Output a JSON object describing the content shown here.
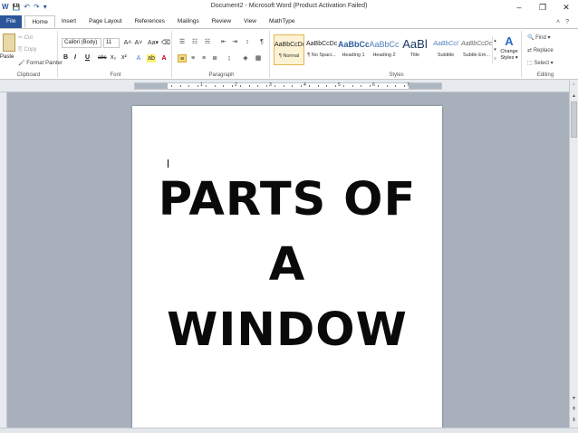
{
  "window": {
    "title": "Document2 - Microsoft Word (Product Activation Failed)",
    "controls": {
      "minimize": "–",
      "maximize": "❐",
      "close": "✕"
    }
  },
  "quick_access": {
    "word_icon": "W",
    "save": "💾",
    "undo": "↶",
    "redo": "↷",
    "customize": "▾"
  },
  "tabs": [
    "File",
    "Home",
    "Insert",
    "Page Layout",
    "References",
    "Mailings",
    "Review",
    "View",
    "MathType"
  ],
  "ribbon": {
    "clipboard": {
      "paste": "Paste",
      "cut": "Cut",
      "copy": "Copy",
      "format_painter": "Format Painter",
      "label": "Clipboard"
    },
    "font": {
      "name": "Calibri (Body)",
      "size": "11",
      "grow": "A˄",
      "shrink": "A˅",
      "change_case": "Aa▾",
      "clear": "⌫",
      "bold": "B",
      "italic": "I",
      "underline": "U",
      "strike": "abc",
      "subscript": "x₂",
      "superscript": "x²",
      "label": "Font"
    },
    "paragraph": {
      "label": "Paragraph",
      "pilcrow": "¶"
    },
    "styles": {
      "items": [
        {
          "sample": "AaBbCcDc",
          "name": "¶ Normal"
        },
        {
          "sample": "AaBbCcDc",
          "name": "¶ No Spaci..."
        },
        {
          "sample": "AaBbCc",
          "name": "Heading 1"
        },
        {
          "sample": "AaBbCc",
          "name": "Heading 2"
        },
        {
          "sample": "AaBl",
          "name": "Title"
        },
        {
          "sample": "AaBbCcI",
          "name": "Subtitle"
        },
        {
          "sample": "AaBbCcDc",
          "name": "Subtle Em..."
        }
      ],
      "change_styles": "Change Styles ▾",
      "label": "Styles"
    },
    "editing": {
      "find": "Find ▾",
      "replace": "Replace",
      "select": "Select ▾",
      "label": "Editing"
    }
  },
  "ruler": {
    "numbers": [
      "1",
      "2",
      "3",
      "4",
      "5",
      "6",
      "7"
    ]
  },
  "document": {
    "heading_line1": "PARTS OF A",
    "heading_line2": "WINDOW"
  },
  "colors": {
    "file_tab": "#2b579a",
    "ribbon_bg": "#ffffff",
    "workspace": "#a8b0bb",
    "highlight": "#f6d980"
  }
}
